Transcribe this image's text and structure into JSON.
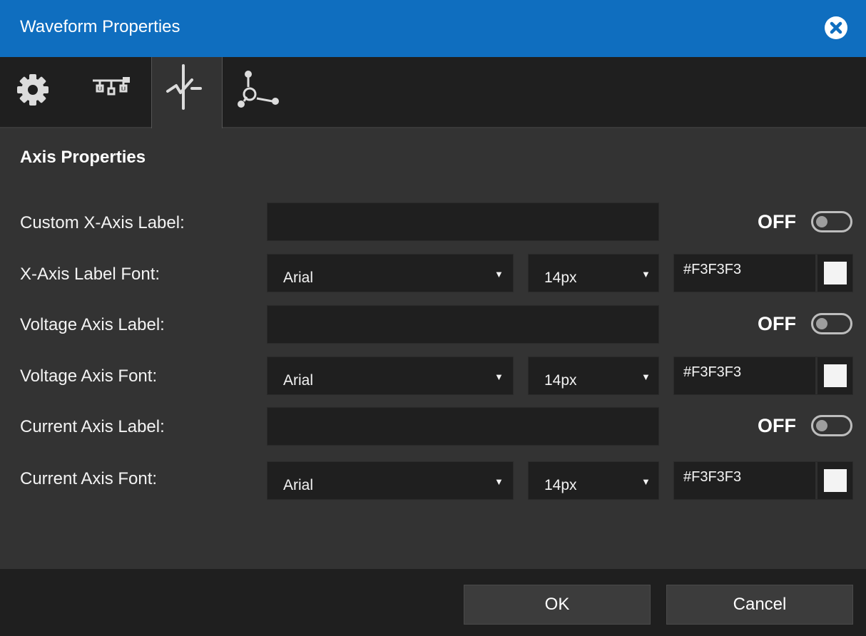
{
  "window": {
    "title": "Waveform Properties"
  },
  "tabs": [
    {
      "icon": "gear-icon"
    },
    {
      "icon": "network-icon"
    },
    {
      "icon": "waveform-icon",
      "active": true
    },
    {
      "icon": "graph-nodes-icon"
    }
  ],
  "section": {
    "title": "Axis Properties"
  },
  "rows": {
    "custom_x_label": {
      "label": "Custom X-Axis Label:",
      "value": "",
      "toggle": "OFF"
    },
    "x_font": {
      "label": "X-Axis Label Font:",
      "font": "Arial",
      "size": "14px",
      "color": "#F3F3F3"
    },
    "voltage_label": {
      "label": "Voltage Axis Label:",
      "value": "",
      "toggle": "OFF"
    },
    "voltage_font": {
      "label": "Voltage Axis Font:",
      "font": "Arial",
      "size": "14px",
      "color": "#F3F3F3"
    },
    "current_label": {
      "label": "Current Axis Label:",
      "value": "",
      "toggle": "OFF"
    },
    "current_font": {
      "label": "Current Axis Font:",
      "font": "Arial",
      "size": "14px",
      "color": "#F3F3F3"
    }
  },
  "footer": {
    "ok": "OK",
    "cancel": "Cancel"
  },
  "colors": {
    "title_bar": "#0f6ebf",
    "panel": "#333333",
    "dark": "#1f1f1f",
    "text": "#f3f3f3"
  }
}
